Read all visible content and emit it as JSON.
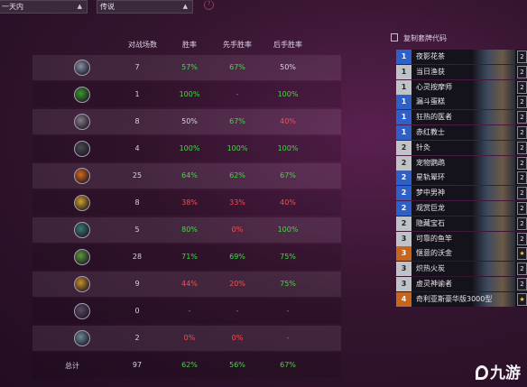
{
  "filters": {
    "time": "一天内",
    "rank": "传说"
  },
  "table": {
    "headers": {
      "games": "对战场数",
      "win": "胜率",
      "first": "先手胜率",
      "second": "后手胜率"
    },
    "rows": [
      {
        "class_icon": "mage-class-icon",
        "icon_color": "#8a8fa8",
        "games": "7",
        "win": "57%",
        "win_color": "green",
        "first": "67%",
        "first_color": "green",
        "second": "50%",
        "second_color": "plain"
      },
      {
        "class_icon": "hunter-class-icon",
        "icon_color": "#3a9a2c",
        "games": "1",
        "win": "100%",
        "win_color": "green",
        "first": "-",
        "first_color": "grey",
        "second": "100%",
        "second_color": "green"
      },
      {
        "class_icon": "warrior-class-icon",
        "icon_color": "#8a7a88",
        "games": "8",
        "win": "50%",
        "win_color": "plain",
        "first": "67%",
        "first_color": "green",
        "second": "40%",
        "second_color": "red"
      },
      {
        "class_icon": "rogue-class-icon",
        "icon_color": "#4a4a50",
        "games": "4",
        "win": "100%",
        "win_color": "green",
        "first": "100%",
        "first_color": "green",
        "second": "100%",
        "second_color": "green"
      },
      {
        "class_icon": "warlock-class-icon",
        "icon_color": "#d8661c",
        "games": "25",
        "win": "64%",
        "win_color": "green",
        "first": "62%",
        "first_color": "green",
        "second": "67%",
        "second_color": "green"
      },
      {
        "class_icon": "paladin-class-icon",
        "icon_color": "#d0a22a",
        "games": "8",
        "win": "38%",
        "win_color": "red",
        "first": "33%",
        "first_color": "red",
        "second": "40%",
        "second_color": "red"
      },
      {
        "class_icon": "shaman-class-icon",
        "icon_color": "#3a7a72",
        "games": "5",
        "win": "80%",
        "win_color": "green",
        "first": "0%",
        "first_color": "red",
        "second": "100%",
        "second_color": "green"
      },
      {
        "class_icon": "druid-class-icon",
        "icon_color": "#5a9a3a",
        "games": "28",
        "win": "71%",
        "win_color": "green",
        "first": "69%",
        "first_color": "green",
        "second": "75%",
        "second_color": "green"
      },
      {
        "class_icon": "priest-class-icon",
        "icon_color": "#c8902a",
        "games": "9",
        "win": "44%",
        "win_color": "red",
        "first": "20%",
        "first_color": "red",
        "second": "75%",
        "second_color": "green"
      },
      {
        "class_icon": "demon-hunter-class-icon",
        "icon_color": "#5a4a66",
        "games": "0",
        "win": "-",
        "win_color": "grey",
        "first": "-",
        "first_color": "grey",
        "second": "-",
        "second_color": "grey"
      },
      {
        "class_icon": "death-knight-class-icon",
        "icon_color": "#6a8a9a",
        "games": "2",
        "win": "0%",
        "win_color": "red",
        "first": "0%",
        "first_color": "red",
        "second": "-",
        "second_color": "grey"
      }
    ],
    "total": {
      "label": "总计",
      "games": "97",
      "win": "62%",
      "first": "56%",
      "second": "67%"
    }
  },
  "deck": {
    "copy_label": "复制套牌代码",
    "cards": [
      {
        "cost": "1",
        "name": "夜影花茶",
        "count": "2",
        "tier": "blue"
      },
      {
        "cost": "1",
        "name": "当日渔获",
        "count": "2",
        "tier": "light"
      },
      {
        "cost": "1",
        "name": "心灵按摩师",
        "count": "2",
        "tier": "light"
      },
      {
        "cost": "1",
        "name": "漏斗蛋糕",
        "count": "2",
        "tier": "blue"
      },
      {
        "cost": "1",
        "name": "狂热的医者",
        "count": "2",
        "tier": "blue"
      },
      {
        "cost": "1",
        "name": "赤红教士",
        "count": "2",
        "tier": "blue"
      },
      {
        "cost": "2",
        "name": "针灸",
        "count": "2",
        "tier": "light"
      },
      {
        "cost": "2",
        "name": "宠物鹦鹉",
        "count": "2",
        "tier": "light"
      },
      {
        "cost": "2",
        "name": "星轨晕环",
        "count": "2",
        "tier": "blue"
      },
      {
        "cost": "2",
        "name": "梦中男神",
        "count": "2",
        "tier": "blue"
      },
      {
        "cost": "2",
        "name": "观赏巨龙",
        "count": "2",
        "tier": "blue"
      },
      {
        "cost": "2",
        "name": "隐藏宝石",
        "count": "2",
        "tier": "light"
      },
      {
        "cost": "3",
        "name": "可靠的鱼竿",
        "count": "2",
        "tier": "light"
      },
      {
        "cost": "3",
        "name": "惬意的沃金",
        "count": "★",
        "tier": "orange"
      },
      {
        "cost": "3",
        "name": "炽热火炭",
        "count": "2",
        "tier": "light"
      },
      {
        "cost": "3",
        "name": "虚灵神谕者",
        "count": "2",
        "tier": "light"
      },
      {
        "cost": "4",
        "name": "奇利亚斯豪华版3000型",
        "count": "★",
        "tier": "orange"
      }
    ]
  },
  "watermark": "九游"
}
